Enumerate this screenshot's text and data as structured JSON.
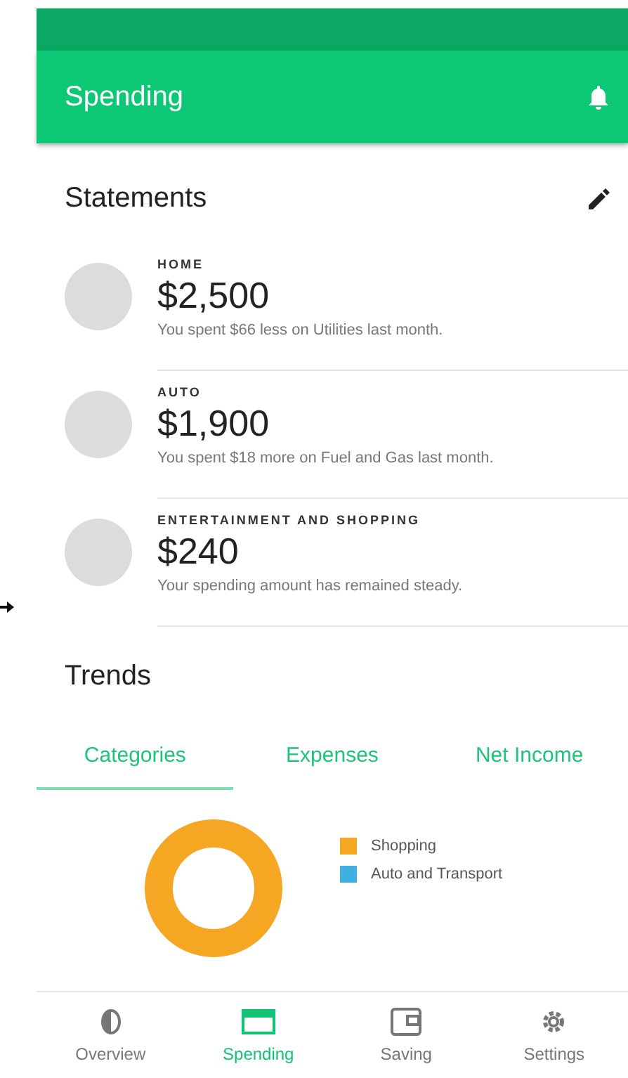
{
  "app_bar": {
    "title": "Spending"
  },
  "statements": {
    "title": "Statements",
    "items": [
      {
        "label": "HOME",
        "amount": "$2,500",
        "note": "You spent $66 less on Utilities last month."
      },
      {
        "label": "AUTO",
        "amount": "$1,900",
        "note": "You spent $18 more on Fuel and Gas last month."
      },
      {
        "label": "ENTERTAINMENT AND SHOPPING",
        "amount": "$240",
        "note": "Your spending amount has remained steady."
      }
    ]
  },
  "trends": {
    "title": "Trends",
    "tabs": [
      {
        "label": "Categories",
        "selected": true
      },
      {
        "label": "Expenses",
        "selected": false
      },
      {
        "label": "Net Income",
        "selected": false
      }
    ],
    "legend": [
      {
        "label": "Shopping",
        "color": "#f5a623"
      },
      {
        "label": "Auto and Transport",
        "color": "#3fb0e0"
      }
    ]
  },
  "bottom_nav": [
    {
      "label": "Overview",
      "kind": "overview",
      "selected": false
    },
    {
      "label": "Spending",
      "kind": "spending",
      "selected": true
    },
    {
      "label": "Saving",
      "kind": "saving",
      "selected": false
    },
    {
      "label": "Settings",
      "kind": "settings",
      "selected": false
    }
  ]
}
